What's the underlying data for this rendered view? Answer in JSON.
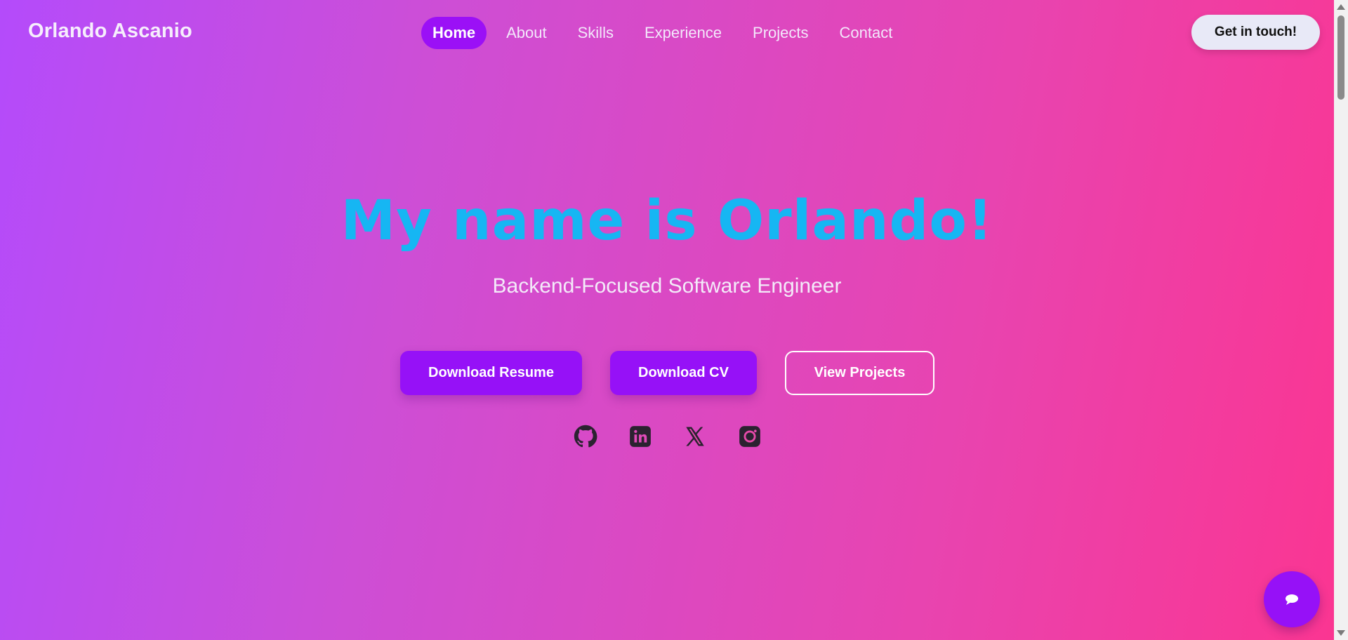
{
  "header": {
    "brand": "Orlando Ascanio",
    "nav": [
      {
        "label": "Home",
        "active": true
      },
      {
        "label": "About"
      },
      {
        "label": "Skills"
      },
      {
        "label": "Experience"
      },
      {
        "label": "Projects"
      },
      {
        "label": "Contact"
      }
    ],
    "cta_label": "Get in touch!"
  },
  "hero": {
    "title": "My name is Orlando!",
    "subtitle": "Backend-Focused Software Engineer",
    "buttons": {
      "resume": "Download Resume",
      "cv": "Download CV",
      "projects": "View Projects"
    },
    "socials": [
      "github-icon",
      "linkedin-icon",
      "x-icon",
      "instagram-icon"
    ]
  },
  "chat": {
    "icon": "chat-bubble-icon"
  },
  "colors": {
    "gradient_start": "#b44bfb",
    "gradient_end": "#fb3591",
    "accent": "#9611f7",
    "title": "#16b6f3"
  }
}
